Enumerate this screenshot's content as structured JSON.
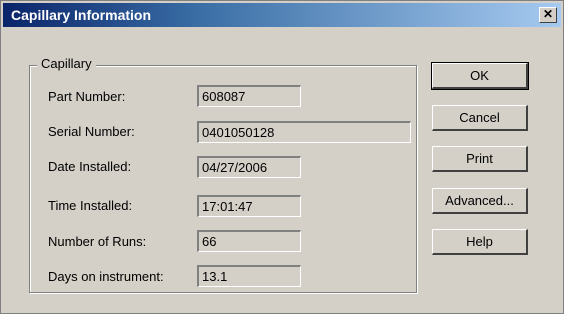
{
  "window": {
    "title": "Capillary Information",
    "close_label": "✕"
  },
  "group": {
    "label": "Capillary",
    "fields": [
      {
        "label": "Part Number:",
        "value": "608087"
      },
      {
        "label": "Serial Number:",
        "value": "0401050128"
      },
      {
        "label": "Date Installed:",
        "value": "04/27/2006"
      },
      {
        "label": "Time Installed:",
        "value": "17:01:47"
      },
      {
        "label": "Number of Runs:",
        "value": "66"
      },
      {
        "label": "Days on instrument:",
        "value": "13.1"
      }
    ]
  },
  "buttons": {
    "ok": "OK",
    "cancel": "Cancel",
    "print": "Print",
    "advanced": "Advanced...",
    "help": "Help"
  }
}
